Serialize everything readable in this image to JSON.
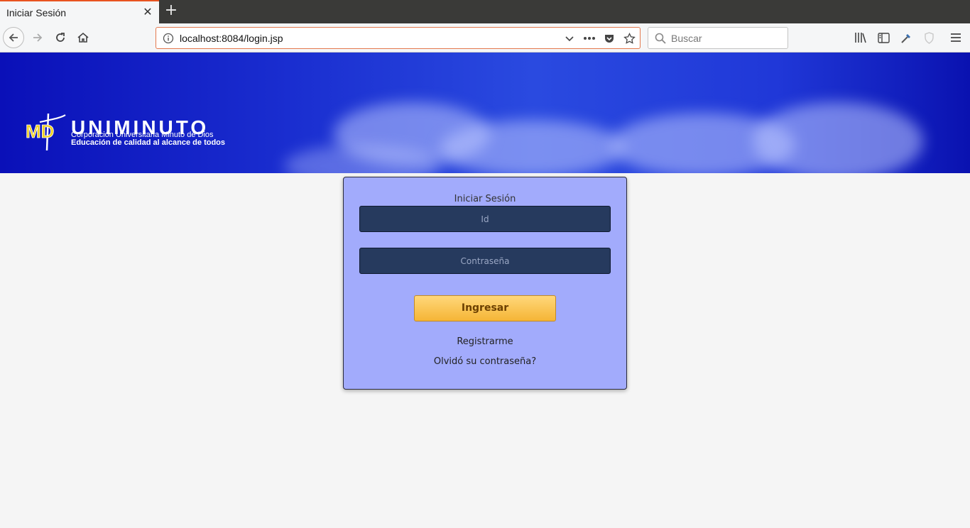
{
  "browser": {
    "tab": {
      "title": "Iniciar Sesión",
      "close_glyph": "✕"
    },
    "new_tab_glyph": "+",
    "url": "localhost:8084/login.jsp",
    "search_placeholder": "Buscar",
    "icons": [
      "back-icon",
      "forward-icon",
      "reload-icon",
      "home-icon",
      "info-icon",
      "chevron-down-icon",
      "more-icon",
      "pocket-icon",
      "star-icon",
      "search-icon",
      "library-icon",
      "sidebar-icon",
      "eyedropper-icon",
      "shield-icon",
      "menu-icon"
    ]
  },
  "banner": {
    "logo_initials": "MD",
    "brand": "UNIMINUTO",
    "subtitle": "Corporación Universitaria Minuto de Dios",
    "tagline": "Educación de calidad al alcance de todos",
    "colors": {
      "sky": "#1a2ed0",
      "logo_yellow": "#f0d020"
    }
  },
  "login": {
    "title": "Iniciar Sesión",
    "id_placeholder": "Id",
    "password_placeholder": "Contraseña",
    "submit_label": "Ingresar",
    "register_link": "Registrarme",
    "forgot_link": "Olvidó su contraseña?",
    "colors": {
      "panel": "#a2abfc",
      "field": "#263a5e",
      "button": "#f5b536"
    }
  }
}
